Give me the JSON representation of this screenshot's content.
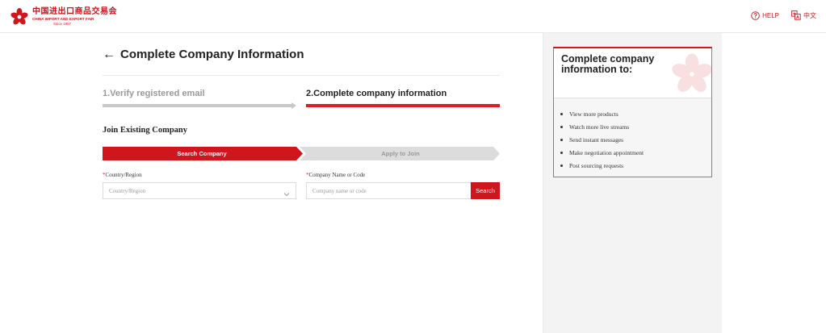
{
  "header": {
    "logo_cn": "中国进出口商品交易会",
    "logo_en": "CHINA IMPORT AND EXPORT FAIR",
    "logo_since": "Since 1957",
    "help_label": "HELP",
    "lang_label": "中文"
  },
  "page": {
    "back_arrow": "←",
    "title": "Complete Company Information"
  },
  "steps": [
    {
      "label": "1.Verify registered email"
    },
    {
      "label": "2.Complete company information"
    }
  ],
  "section": {
    "title": "Join Existing Company",
    "sub_steps": [
      {
        "label": "Search Company"
      },
      {
        "label": "Apply to Join"
      }
    ]
  },
  "form": {
    "required_mark": "*",
    "country_label": "Country/Region",
    "country_placeholder": "Country/Region",
    "company_label": "Company Name or Code",
    "company_placeholder": "Company name or code",
    "search_button": "Search"
  },
  "sidebar": {
    "title": "Complete company information to:",
    "items": [
      "View more products",
      "Watch more live streams",
      "Send instant messages",
      "Make negotiation appointment",
      "Post sourcing requests"
    ]
  },
  "colors": {
    "brand_red": "#d0161d",
    "progress_red": "#e31d1f",
    "inactive_gray": "#c8c8c8"
  }
}
